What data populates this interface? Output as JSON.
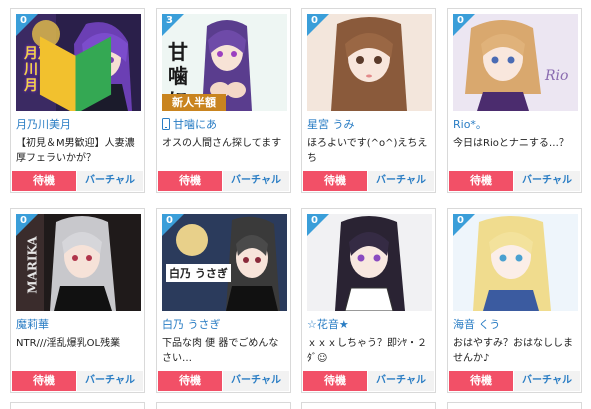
{
  "colors": {
    "accent_blue": "#3a9ed9",
    "name_blue": "#2a7dc4",
    "status_red": "#f25067",
    "badge_gold": "#c9841f"
  },
  "cards": [
    {
      "count": "0",
      "name": "月乃川美月",
      "message": "【初見＆M男歓迎】人妻濃厚フェラいかが？",
      "status": "待機",
      "type": "バーチャル",
      "thumb_text": "月乃川 美月",
      "badge": "",
      "beginner_icon": "beginner-leaf-icon"
    },
    {
      "count": "3",
      "name": "甘噛にあ",
      "message": "オスの人間さん探してます",
      "status": "待機",
      "type": "バーチャル",
      "thumb_text": "甘噛 にあ",
      "badge": "新人半額",
      "name_icon": "smartphone-icon"
    },
    {
      "count": "0",
      "name": "星宮 うみ",
      "message": "ほろよいです(^o^)えちえち",
      "status": "待機",
      "type": "バーチャル",
      "thumb_text": "",
      "badge": ""
    },
    {
      "count": "0",
      "name": "Rio*。",
      "message": "今日はRioとナニする…？",
      "status": "待機",
      "type": "バーチャル",
      "thumb_text": "Rio",
      "badge": ""
    },
    {
      "count": "0",
      "name": "魔莉華",
      "message": "NTR///淫乱爆乳OL残業",
      "status": "待機",
      "type": "バーチャル",
      "thumb_text": "MARIKA",
      "badge": ""
    },
    {
      "count": "0",
      "name": "白乃 うさぎ",
      "message": "下品な肉 便 器でごめんなさい…",
      "status": "待機",
      "type": "バーチャル",
      "thumb_text": "白乃 うさぎ",
      "badge": ""
    },
    {
      "count": "0",
      "name": "☆花音★",
      "message": "ｘｘｘしちゃう？即ｼﾔ・２ﾀﾞ☺",
      "status": "待機",
      "type": "バーチャル",
      "thumb_text": "",
      "badge": ""
    },
    {
      "count": "0",
      "name": "海音 くう",
      "message": "おはやすみ？おはなししませんか♪",
      "status": "待機",
      "type": "バーチャル",
      "thumb_text": "",
      "badge": ""
    }
  ]
}
